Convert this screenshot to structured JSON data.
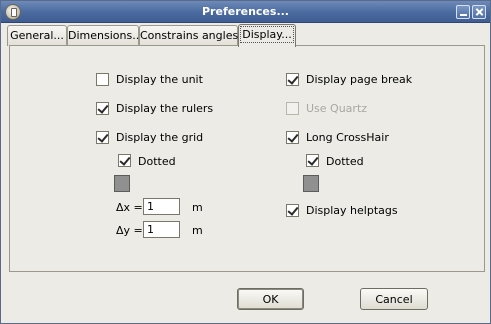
{
  "window": {
    "title": "Preferences..."
  },
  "tabs": [
    {
      "label": "General..."
    },
    {
      "label": "Dimensions..."
    },
    {
      "label": "Constrains angles..."
    },
    {
      "label": "Display..."
    }
  ],
  "left": {
    "display_unit": {
      "label": "Display the unit",
      "checked": false
    },
    "display_rulers": {
      "label": "Display the rulers",
      "checked": true
    },
    "display_grid": {
      "label": "Display the grid",
      "checked": true
    },
    "grid_dotted": {
      "label": "Dotted",
      "checked": true
    },
    "grid_color": "#909090",
    "delta_x": {
      "label": "Δx =",
      "value": "1",
      "unit": "m"
    },
    "delta_y": {
      "label": "Δy =",
      "value": "1",
      "unit": "m"
    }
  },
  "right": {
    "page_break": {
      "label": "Display page break",
      "checked": true
    },
    "use_quartz": {
      "label": "Use Quartz",
      "checked": false,
      "disabled": true
    },
    "long_crosshair": {
      "label": "Long CrossHair",
      "checked": true
    },
    "crosshair_dotted": {
      "label": "Dotted",
      "checked": true
    },
    "crosshair_color": "#909090",
    "helptags": {
      "label": "Display helptags",
      "checked": true
    }
  },
  "buttons": {
    "ok": "OK",
    "cancel": "Cancel"
  }
}
